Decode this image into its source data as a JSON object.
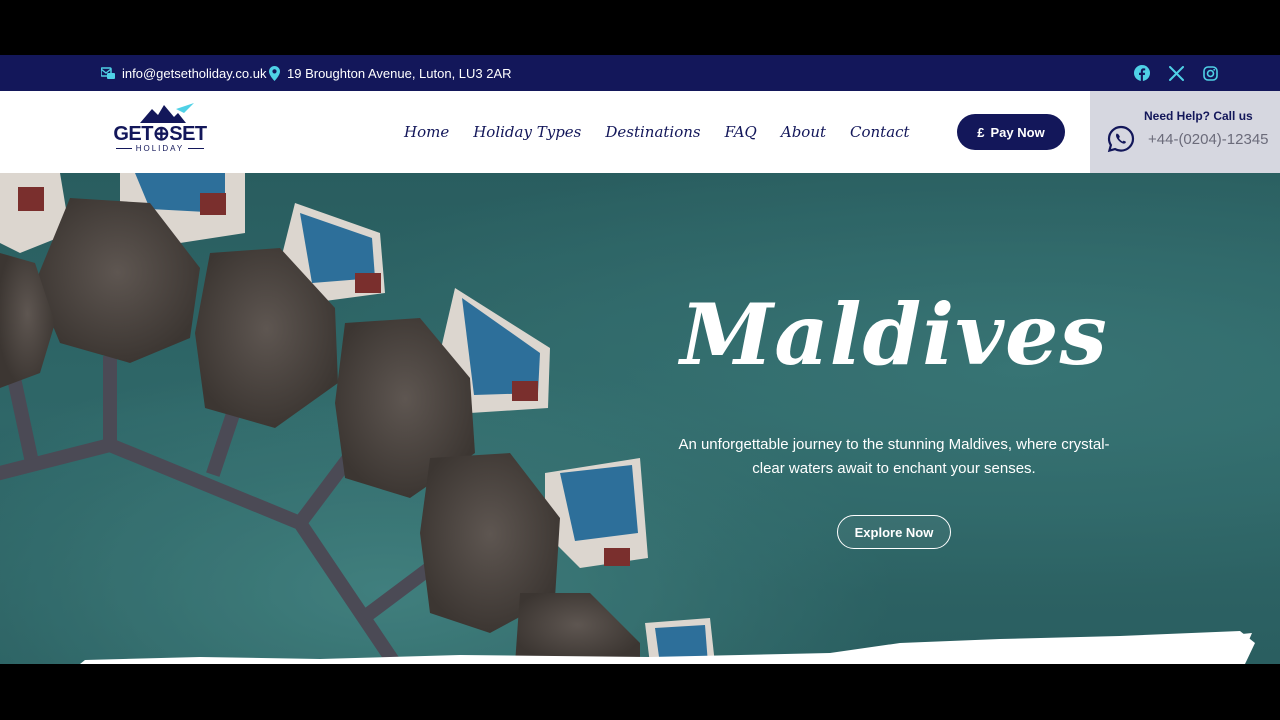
{
  "topbar": {
    "email": "info@getsetholiday.co.uk",
    "address": "19 Broughton Avenue, Luton, LU3 2AR",
    "socials": [
      "facebook-icon",
      "x-icon",
      "instagram-icon"
    ]
  },
  "logo": {
    "brand": "GET⊕SET",
    "sub": "HOLIDAY"
  },
  "nav": [
    "Home",
    "Holiday Types",
    "Destinations",
    "FAQ",
    "About",
    "Contact"
  ],
  "pay_button": {
    "symbol": "£",
    "label": "Pay Now"
  },
  "help": {
    "title": "Need Help? Call us",
    "phone": "+44-(0204)-12345",
    "icon": "whatsapp-icon"
  },
  "hero": {
    "title": "Maldives",
    "text": "An unforgettable journey to the stunning Maldives, where crystal-clear waters await to enchant your senses.",
    "button": "Explore Now"
  },
  "colors": {
    "navy": "#13175a",
    "hero_teal": "#357676",
    "help_bg": "#d6d7e0",
    "icon_cyan": "#4fd1e6"
  }
}
